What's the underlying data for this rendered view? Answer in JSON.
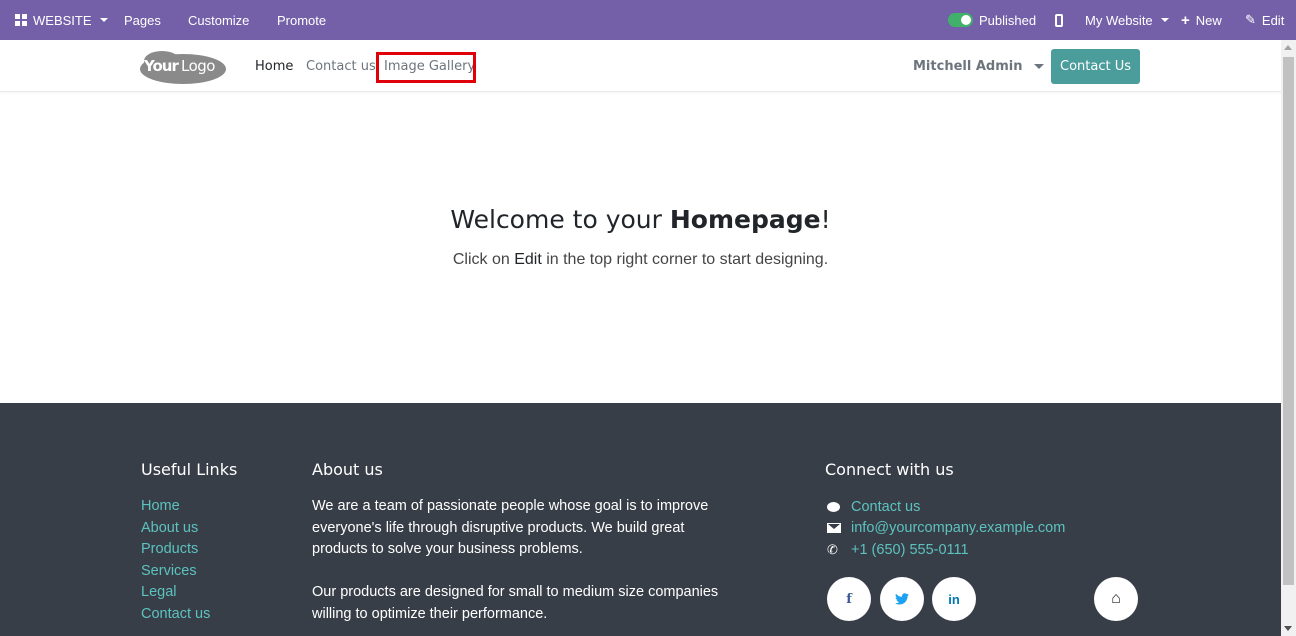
{
  "admin_bar": {
    "app_menu": "WEBSITE",
    "pages": "Pages",
    "customize": "Customize",
    "promote": "Promote",
    "published": "Published",
    "my_website": "My Website",
    "new": "New",
    "edit": "Edit"
  },
  "header": {
    "logo_text": "YourLogo",
    "nav": [
      "Home",
      "Contact us",
      "Image Gallery"
    ],
    "user": "Mitchell Admin",
    "cta": "Contact Us"
  },
  "hero": {
    "title_prefix": "Welcome to your ",
    "title_bold": "Homepage",
    "title_suffix": "!",
    "sub_prefix": "Click on ",
    "sub_em": "Edit",
    "sub_suffix": " in the top right corner to start designing."
  },
  "footer": {
    "useful_links_heading": "Useful Links",
    "useful_links": [
      "Home",
      "About us",
      "Products",
      "Services",
      "Legal",
      "Contact us"
    ],
    "about_heading": "About us",
    "about_p1": "We are a team of passionate people whose goal is to improve everyone's life through disruptive products. We build great products to solve your business problems.",
    "about_p2": "Our products are designed for small to medium size companies willing to optimize their performance.",
    "connect_heading": "Connect with us",
    "contact_link": "Contact us",
    "email": "info@yourcompany.example.com",
    "phone": "+1 (650) 555-0111",
    "social": {
      "facebook": "f",
      "twitter": "🐦",
      "linkedin": "in",
      "home": "⌂"
    }
  },
  "colors": {
    "admin_bar": "#7460a8",
    "footer_bg": "#383e47",
    "footer_link": "#5cc2c0",
    "cta": "#4a9d9b",
    "highlight": "#e0000a",
    "facebook": "#3b5998",
    "twitter": "#1da1f2",
    "linkedin": "#0077b5"
  }
}
